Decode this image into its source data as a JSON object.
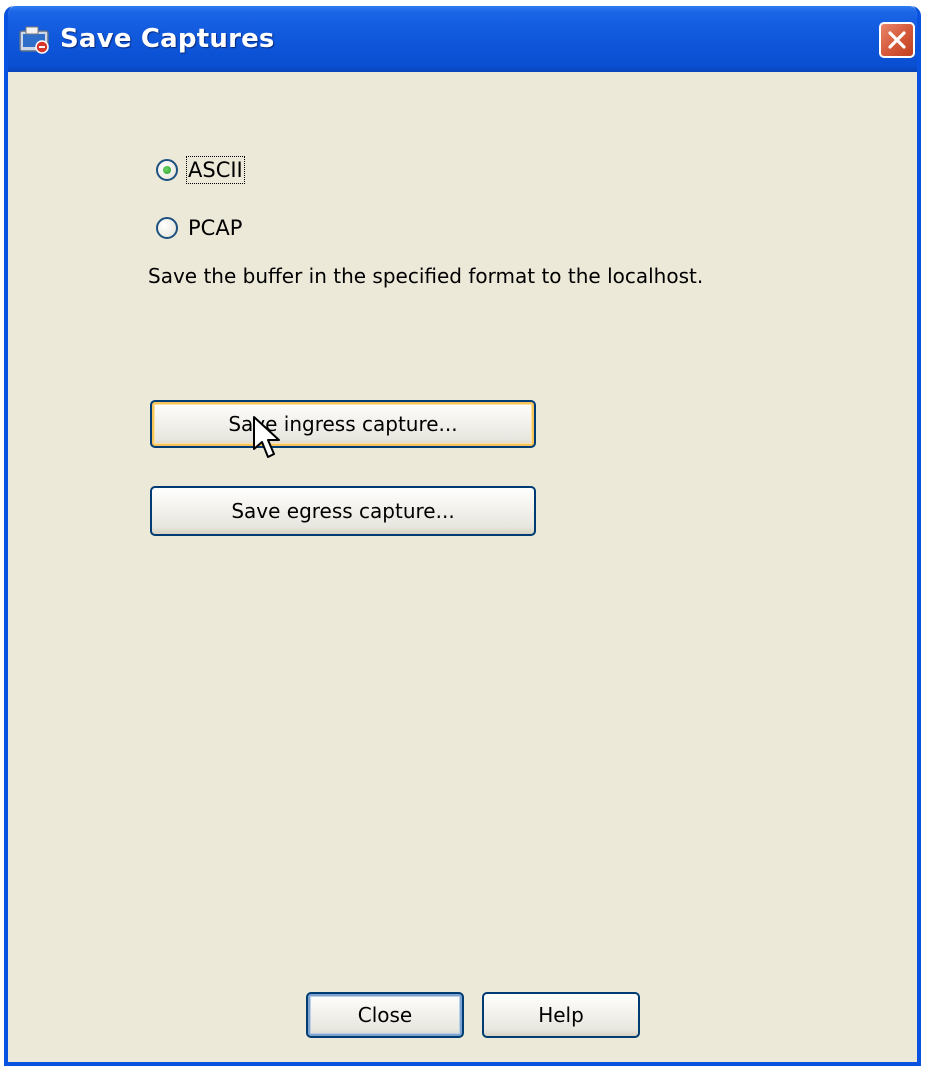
{
  "window": {
    "title": "Save Captures",
    "title_icon": "capture-app-icon",
    "close_icon": "close-icon"
  },
  "format": {
    "options": [
      {
        "label": "ASCII",
        "selected": true
      },
      {
        "label": "PCAP",
        "selected": false
      }
    ],
    "description": "Save the buffer in the specified format to the localhost."
  },
  "actions": {
    "save_ingress_label": "Save ingress capture...",
    "save_egress_label": "Save egress capture..."
  },
  "footer": {
    "close_label": "Close",
    "help_label": "Help"
  },
  "colors": {
    "titlebar": "#0a4fd2",
    "client_bg": "#ece9d8",
    "close_button": "#d65b3c",
    "radio_selected": "#21a121"
  }
}
